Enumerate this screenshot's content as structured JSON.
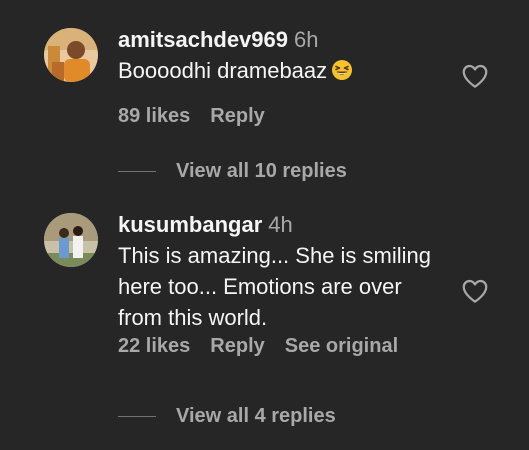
{
  "comments": [
    {
      "username": "amitsachdev969",
      "time": "6h",
      "text": "Boooodhi dramebaaz",
      "emoji": "grinning-squinting-face-icon",
      "likes": "89 likes",
      "reply_label": "Reply",
      "view_replies": "View all 10 replies"
    },
    {
      "username": "kusumbangar",
      "time": "4h",
      "text": "This is amazing... She is smiling here too... Emotions are over from this world.",
      "likes": "22 likes",
      "reply_label": "Reply",
      "see_original": "See original",
      "view_replies": "View all 4 replies"
    }
  ],
  "colors": {
    "background": "#262626",
    "primary_text": "#f5f5f5",
    "secondary_text": "#a8a8a8"
  }
}
